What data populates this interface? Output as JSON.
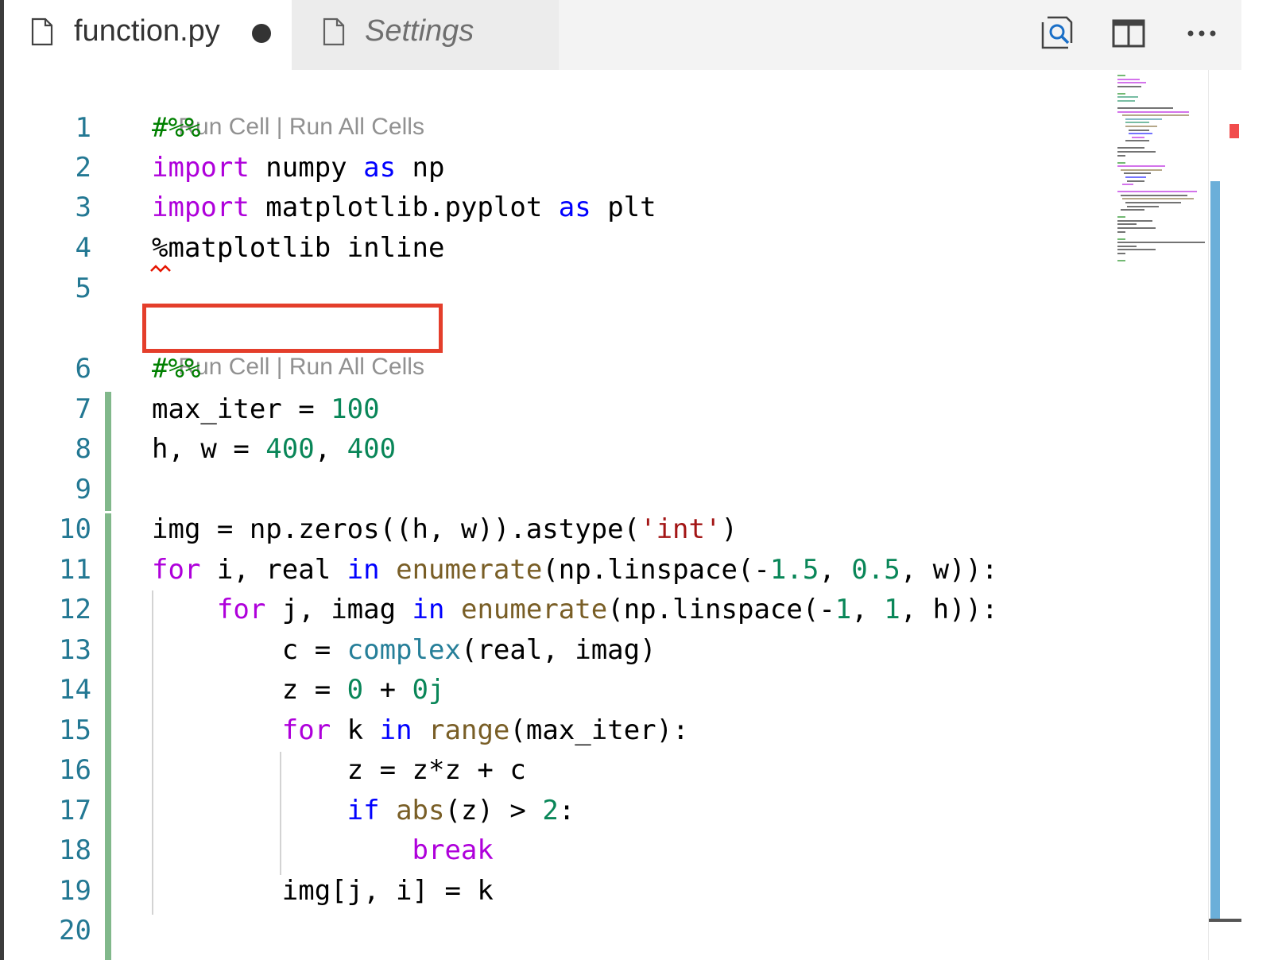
{
  "tabs": [
    {
      "label": "function.py",
      "icon": "file-icon",
      "active": true,
      "dirty": true
    },
    {
      "label": "Settings",
      "icon": "file-icon",
      "active": false,
      "dirty": false
    }
  ],
  "actions": [
    "open-preview-icon",
    "split-editor-icon",
    "more-actions-icon"
  ],
  "codelens": {
    "run_cell": "Run Cell",
    "separator": " | ",
    "run_all": "Run All Cells"
  },
  "lines": [
    {
      "num": "1",
      "tokens": [
        [
          "cm",
          "#%%"
        ]
      ]
    },
    {
      "num": "2",
      "tokens": [
        [
          "kw",
          "import"
        ],
        [
          "",
          " numpy "
        ],
        [
          "bl",
          "as"
        ],
        [
          "",
          " np"
        ]
      ]
    },
    {
      "num": "3",
      "tokens": [
        [
          "kw",
          "import"
        ],
        [
          "",
          " matplotlib.pyplot "
        ],
        [
          "bl",
          "as"
        ],
        [
          "",
          " plt"
        ]
      ]
    },
    {
      "num": "4",
      "tokens": [
        [
          "",
          "%matplotlib inline"
        ]
      ]
    },
    {
      "num": "5",
      "tokens": []
    },
    {
      "num": "6",
      "tokens": [
        [
          "cm",
          "#%%"
        ]
      ]
    },
    {
      "num": "7",
      "tokens": [
        [
          "",
          "max_iter = "
        ],
        [
          "num",
          "100"
        ]
      ]
    },
    {
      "num": "8",
      "tokens": [
        [
          "",
          "h, w = "
        ],
        [
          "num",
          "400"
        ],
        [
          "",
          ", "
        ],
        [
          "num",
          "400"
        ]
      ]
    },
    {
      "num": "9",
      "tokens": []
    },
    {
      "num": "10",
      "tokens": [
        [
          "",
          "img = np.zeros((h, w)).astype("
        ],
        [
          "str",
          "'int'"
        ],
        [
          "",
          ")"
        ]
      ]
    },
    {
      "num": "11",
      "tokens": [
        [
          "kw",
          "for"
        ],
        [
          "",
          " i, real "
        ],
        [
          "bl",
          "in"
        ],
        [
          "",
          " "
        ],
        [
          "fn",
          "enumerate"
        ],
        [
          "",
          "(np.linspace(-"
        ],
        [
          "num",
          "1.5"
        ],
        [
          "",
          ", "
        ],
        [
          "num",
          "0.5"
        ],
        [
          "",
          ", w)):"
        ]
      ]
    },
    {
      "num": "12",
      "tokens": [
        [
          "",
          "    "
        ],
        [
          "kw",
          "for"
        ],
        [
          "",
          " j, imag "
        ],
        [
          "bl",
          "in"
        ],
        [
          "",
          " "
        ],
        [
          "fn",
          "enumerate"
        ],
        [
          "",
          "(np.linspace(-"
        ],
        [
          "num",
          "1"
        ],
        [
          "",
          ", "
        ],
        [
          "num",
          "1"
        ],
        [
          "",
          ", h)):"
        ]
      ]
    },
    {
      "num": "13",
      "tokens": [
        [
          "",
          "        c = "
        ],
        [
          "ty",
          "complex"
        ],
        [
          "",
          "(real, imag)"
        ]
      ]
    },
    {
      "num": "14",
      "tokens": [
        [
          "",
          "        z = "
        ],
        [
          "num",
          "0"
        ],
        [
          "",
          " + "
        ],
        [
          "num",
          "0j"
        ]
      ]
    },
    {
      "num": "15",
      "tokens": [
        [
          "",
          "        "
        ],
        [
          "kw",
          "for"
        ],
        [
          "",
          " k "
        ],
        [
          "bl",
          "in"
        ],
        [
          "",
          " "
        ],
        [
          "fn",
          "range"
        ],
        [
          "",
          "(max_iter):"
        ]
      ]
    },
    {
      "num": "16",
      "tokens": [
        [
          "",
          "            z = z*z + c"
        ]
      ]
    },
    {
      "num": "17",
      "tokens": [
        [
          "",
          "            "
        ],
        [
          "bl",
          "if"
        ],
        [
          "",
          " "
        ],
        [
          "fn",
          "abs"
        ],
        [
          "",
          "(z) > "
        ],
        [
          "num",
          "2"
        ],
        [
          "",
          ":"
        ]
      ]
    },
    {
      "num": "18",
      "tokens": [
        [
          "",
          "                "
        ],
        [
          "kw",
          "break"
        ]
      ]
    },
    {
      "num": "19",
      "tokens": [
        [
          "",
          "        img[j, i] = k"
        ]
      ]
    },
    {
      "num": "20",
      "tokens": []
    }
  ],
  "colors": {
    "keyword": "#af00db",
    "control": "#0000ff",
    "number": "#098658",
    "string": "#a31515",
    "function": "#795e26",
    "type": "#267f99",
    "comment": "#008000",
    "line_number": "#237893",
    "modified_gutter": "#81b88b",
    "highlight_box": "#e43e2b"
  }
}
